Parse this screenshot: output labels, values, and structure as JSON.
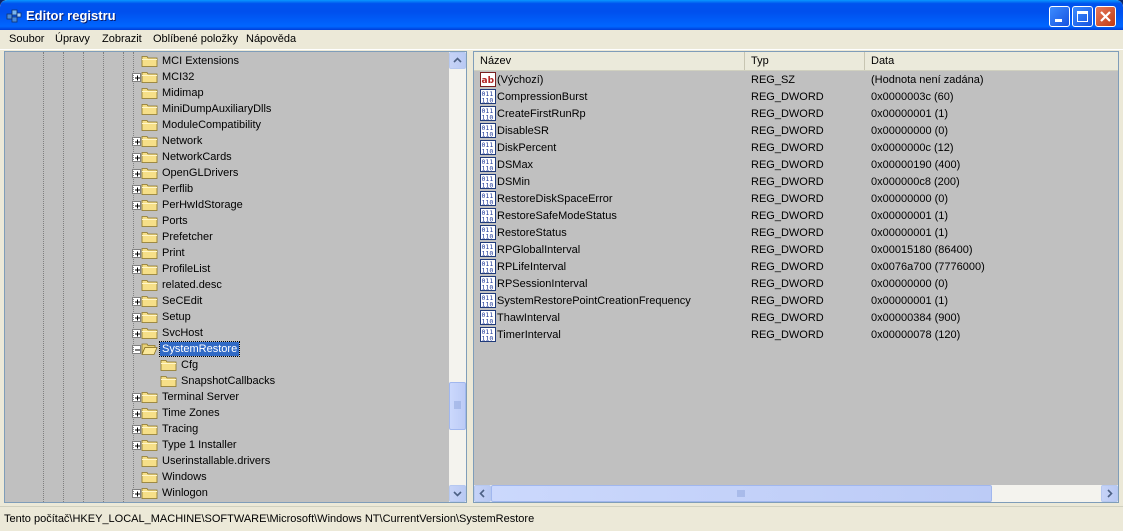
{
  "window": {
    "title": "Editor registru"
  },
  "menu": [
    "Soubor",
    "Úpravy",
    "Zobrazit",
    "Oblíbené položky",
    "Nápověda"
  ],
  "tree": {
    "items": [
      {
        "label": "MCI Extensions",
        "level": 1,
        "expandable": false
      },
      {
        "label": "MCI32",
        "level": 1,
        "expandable": true
      },
      {
        "label": "Midimap",
        "level": 1,
        "expandable": false
      },
      {
        "label": "MiniDumpAuxiliaryDlls",
        "level": 1,
        "expandable": false
      },
      {
        "label": "ModuleCompatibility",
        "level": 1,
        "expandable": false
      },
      {
        "label": "Network",
        "level": 1,
        "expandable": true
      },
      {
        "label": "NetworkCards",
        "level": 1,
        "expandable": true
      },
      {
        "label": "OpenGLDrivers",
        "level": 1,
        "expandable": true
      },
      {
        "label": "Perflib",
        "level": 1,
        "expandable": true
      },
      {
        "label": "PerHwIdStorage",
        "level": 1,
        "expandable": true
      },
      {
        "label": "Ports",
        "level": 1,
        "expandable": false
      },
      {
        "label": "Prefetcher",
        "level": 1,
        "expandable": false
      },
      {
        "label": "Print",
        "level": 1,
        "expandable": true
      },
      {
        "label": "ProfileList",
        "level": 1,
        "expandable": true
      },
      {
        "label": "related.desc",
        "level": 1,
        "expandable": false
      },
      {
        "label": "SeCEdit",
        "level": 1,
        "expandable": true
      },
      {
        "label": "Setup",
        "level": 1,
        "expandable": true
      },
      {
        "label": "SvcHost",
        "level": 1,
        "expandable": true
      },
      {
        "label": "SystemRestore",
        "level": 1,
        "expandable": true,
        "expanded": true,
        "selected": true
      },
      {
        "label": "Cfg",
        "level": 2,
        "expandable": false
      },
      {
        "label": "SnapshotCallbacks",
        "level": 2,
        "expandable": false
      },
      {
        "label": "Terminal Server",
        "level": 1,
        "expandable": true
      },
      {
        "label": "Time Zones",
        "level": 1,
        "expandable": true
      },
      {
        "label": "Tracing",
        "level": 1,
        "expandable": true
      },
      {
        "label": "Type 1 Installer",
        "level": 1,
        "expandable": true
      },
      {
        "label": "Userinstallable.drivers",
        "level": 1,
        "expandable": false
      },
      {
        "label": "Windows",
        "level": 1,
        "expandable": false
      },
      {
        "label": "Winlogon",
        "level": 1,
        "expandable": true
      }
    ]
  },
  "list": {
    "columns": [
      "Název",
      "Typ",
      "Data"
    ],
    "rows": [
      {
        "icon": "string-value-icon",
        "name": "(Výchozí)",
        "type": "REG_SZ",
        "data": "(Hodnota není zadána)"
      },
      {
        "icon": "binary-value-icon",
        "name": "CompressionBurst",
        "type": "REG_DWORD",
        "data": "0x0000003c (60)"
      },
      {
        "icon": "binary-value-icon",
        "name": "CreateFirstRunRp",
        "type": "REG_DWORD",
        "data": "0x00000001 (1)"
      },
      {
        "icon": "binary-value-icon",
        "name": "DisableSR",
        "type": "REG_DWORD",
        "data": "0x00000000 (0)"
      },
      {
        "icon": "binary-value-icon",
        "name": "DiskPercent",
        "type": "REG_DWORD",
        "data": "0x0000000c (12)"
      },
      {
        "icon": "binary-value-icon",
        "name": "DSMax",
        "type": "REG_DWORD",
        "data": "0x00000190 (400)"
      },
      {
        "icon": "binary-value-icon",
        "name": "DSMin",
        "type": "REG_DWORD",
        "data": "0x000000c8 (200)"
      },
      {
        "icon": "binary-value-icon",
        "name": "RestoreDiskSpaceError",
        "type": "REG_DWORD",
        "data": "0x00000000 (0)"
      },
      {
        "icon": "binary-value-icon",
        "name": "RestoreSafeModeStatus",
        "type": "REG_DWORD",
        "data": "0x00000001 (1)"
      },
      {
        "icon": "binary-value-icon",
        "name": "RestoreStatus",
        "type": "REG_DWORD",
        "data": "0x00000001 (1)"
      },
      {
        "icon": "binary-value-icon",
        "name": "RPGlobalInterval",
        "type": "REG_DWORD",
        "data": "0x00015180 (86400)"
      },
      {
        "icon": "binary-value-icon",
        "name": "RPLifeInterval",
        "type": "REG_DWORD",
        "data": "0x0076a700 (7776000)"
      },
      {
        "icon": "binary-value-icon",
        "name": "RPSessionInterval",
        "type": "REG_DWORD",
        "data": "0x00000000 (0)"
      },
      {
        "icon": "binary-value-icon",
        "name": "SystemRestorePointCreationFrequency",
        "type": "REG_DWORD",
        "data": "0x00000001 (1)"
      },
      {
        "icon": "binary-value-icon",
        "name": "ThawInterval",
        "type": "REG_DWORD",
        "data": "0x00000384 (900)"
      },
      {
        "icon": "binary-value-icon",
        "name": "TimerInterval",
        "type": "REG_DWORD",
        "data": "0x00000078 (120)"
      }
    ]
  },
  "status": {
    "path": "Tento počítač\\HKEY_LOCAL_MACHINE\\SOFTWARE\\Microsoft\\Windows NT\\CurrentVersion\\SystemRestore"
  },
  "colors": {
    "titlebar": "#0054e3",
    "selection": "#316ac5",
    "pane_background": "#c0c0c0",
    "chrome": "#ece9d8"
  }
}
